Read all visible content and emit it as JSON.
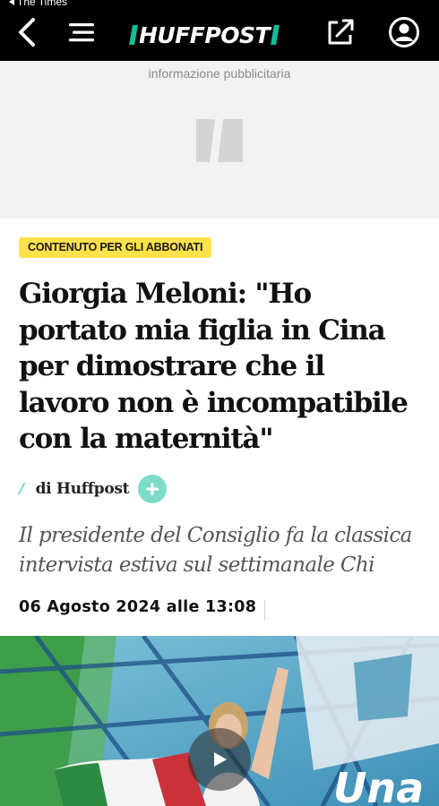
{
  "status_bar": {
    "back_app": "The Times"
  },
  "header": {
    "logo_text": "HUFFPOST"
  },
  "ad": {
    "label": "informazione pubblicitaria"
  },
  "article": {
    "badge": "CONTENUTO PER GLI ABBONATI",
    "headline": "Giorgia Meloni: \"Ho portato mia figlia in Cina per dimostrare che il lavoro non è incompatibile con la maternità\"",
    "author": "di Huffpost",
    "subtitle": "Il presidente del Consiglio fa la classica intervista estiva sul settimanale Chi",
    "date": "06 Agosto 2024 alle 13:08",
    "video_overlay_text": "Una"
  },
  "colors": {
    "brand_accent": "#0dbe98",
    "badge_bg": "#ffe24a",
    "header_bg": "#000000"
  },
  "icons": [
    "back-arrow-icon",
    "hamburger-menu-icon",
    "share-icon",
    "account-icon",
    "plus-icon",
    "play-icon"
  ]
}
